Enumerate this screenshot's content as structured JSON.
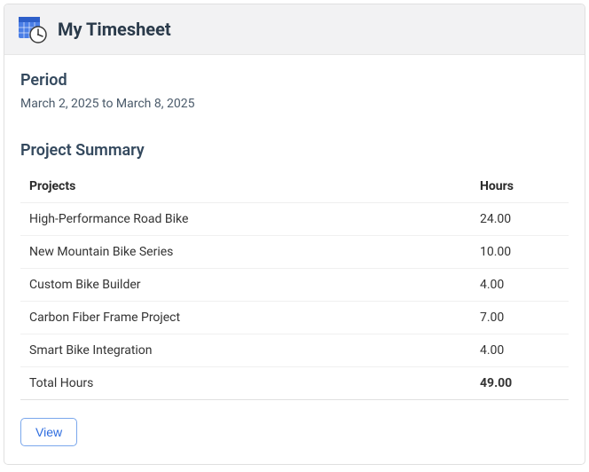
{
  "header": {
    "title": "My Timesheet",
    "icon": "timesheet-clock-icon"
  },
  "period": {
    "label": "Period",
    "text": "March 2, 2025 to March 8, 2025"
  },
  "summary": {
    "label": "Project Summary",
    "columns": {
      "projects": "Projects",
      "hours": "Hours"
    },
    "rows": [
      {
        "project": "High-Performance Road Bike",
        "hours": "24.00"
      },
      {
        "project": "New Mountain Bike Series",
        "hours": "10.00"
      },
      {
        "project": "Custom Bike Builder",
        "hours": "4.00"
      },
      {
        "project": "Carbon Fiber Frame Project",
        "hours": "7.00"
      },
      {
        "project": "Smart Bike Integration",
        "hours": "4.00"
      }
    ],
    "total": {
      "label": "Total Hours",
      "hours": "49.00"
    }
  },
  "actions": {
    "view": "View"
  }
}
